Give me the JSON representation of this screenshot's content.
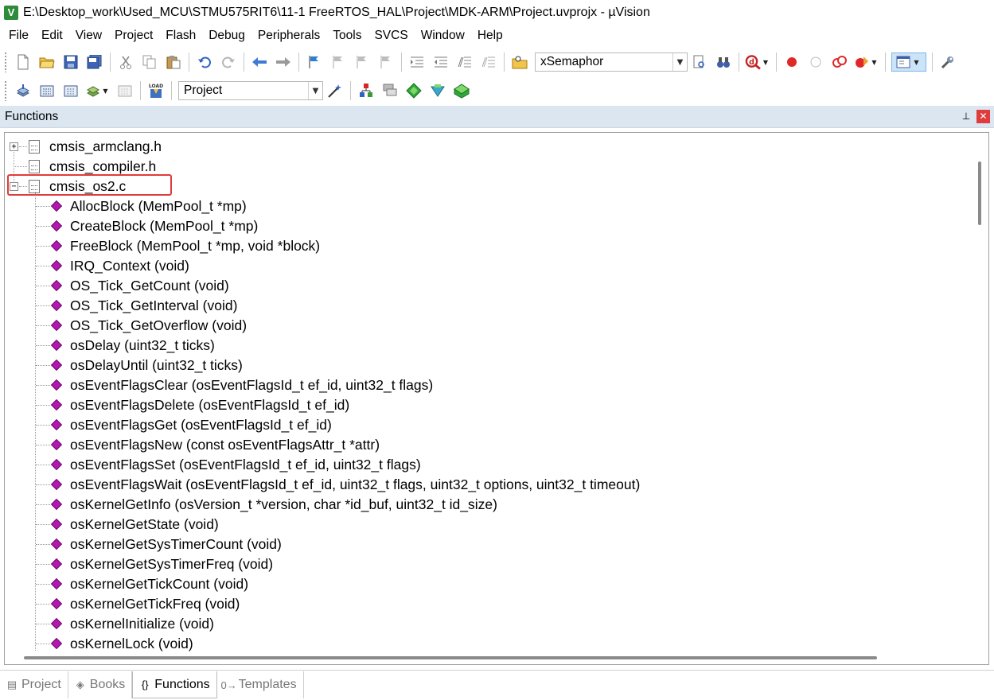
{
  "window": {
    "title": "E:\\Desktop_work\\Used_MCU\\STMU575RIT6\\11-1 FreeRTOS_HAL\\Project\\MDK-ARM\\Project.uvprojx - µVision",
    "app_icon_letter": "V"
  },
  "menu": [
    "File",
    "Edit",
    "View",
    "Project",
    "Flash",
    "Debug",
    "Peripherals",
    "Tools",
    "SVCS",
    "Window",
    "Help"
  ],
  "toolbar1": {
    "find_combo_value": "xSemaphor"
  },
  "toolbar2": {
    "target_combo_value": "Project",
    "load_label": "LOAD"
  },
  "panel": {
    "title": "Functions",
    "pin_glyph": "⊥",
    "close_glyph": "✕"
  },
  "tree": {
    "files": [
      {
        "name": "cmsis_armclang.h",
        "expander": "+",
        "highlighted": false
      },
      {
        "name": "cmsis_compiler.h",
        "expander": "",
        "highlighted": false
      },
      {
        "name": "cmsis_os2.c",
        "expander": "−",
        "highlighted": true
      }
    ],
    "functions": [
      "AllocBlock (MemPool_t *mp)",
      "CreateBlock (MemPool_t *mp)",
      "FreeBlock (MemPool_t *mp, void *block)",
      "IRQ_Context (void)",
      "OS_Tick_GetCount (void)",
      "OS_Tick_GetInterval (void)",
      "OS_Tick_GetOverflow (void)",
      "osDelay (uint32_t ticks)",
      "osDelayUntil (uint32_t ticks)",
      "osEventFlagsClear (osEventFlagsId_t ef_id, uint32_t flags)",
      "osEventFlagsDelete (osEventFlagsId_t ef_id)",
      "osEventFlagsGet (osEventFlagsId_t ef_id)",
      "osEventFlagsNew (const osEventFlagsAttr_t *attr)",
      "osEventFlagsSet (osEventFlagsId_t ef_id, uint32_t flags)",
      "osEventFlagsWait (osEventFlagsId_t ef_id, uint32_t flags, uint32_t options, uint32_t timeout)",
      "osKernelGetInfo (osVersion_t *version, char *id_buf, uint32_t id_size)",
      "osKernelGetState (void)",
      "osKernelGetSysTimerCount (void)",
      "osKernelGetSysTimerFreq (void)",
      "osKernelGetTickCount (void)",
      "osKernelGetTickFreq (void)",
      "osKernelInitialize (void)",
      "osKernelLock (void)"
    ]
  },
  "tabs": [
    {
      "label": "Project",
      "icon": "project-tab-icon",
      "glyph": "▤",
      "active": false
    },
    {
      "label": "Books",
      "icon": "books-tab-icon",
      "glyph": "◈",
      "active": false
    },
    {
      "label": "Functions",
      "icon": "functions-tab-icon",
      "glyph": "{}",
      "active": true
    },
    {
      "label": "Templates",
      "icon": "templates-tab-icon",
      "glyph": "0→",
      "active": false
    }
  ],
  "colors": {
    "function_icon": "#b218b0",
    "highlight_box": "#e23b3b",
    "panel_header": "#dbe6f1"
  }
}
